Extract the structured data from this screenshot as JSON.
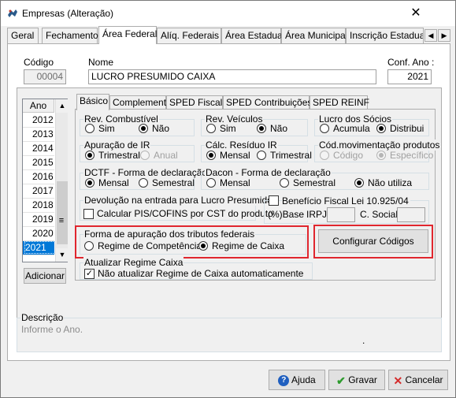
{
  "window": {
    "title": "Empresas (Alteração)",
    "close_symbol": "✕"
  },
  "top_tabs": [
    {
      "label": "Geral"
    },
    {
      "label": "Fechamento"
    },
    {
      "label": "Área Federal"
    },
    {
      "label": "Alíq. Federais"
    },
    {
      "label": "Área Estadual"
    },
    {
      "label": "Área Municipal"
    },
    {
      "label": "Inscrição Estadual S"
    }
  ],
  "header": {
    "codigo_label": "Código",
    "codigo_value": "00004",
    "nome_label": "Nome",
    "nome_value": "LUCRO PRESUMIDO CAIXA",
    "conf_ano_label": "Conf. Ano :",
    "conf_ano_value": "2021"
  },
  "year_grid": {
    "header": "Ano",
    "years": [
      "2012",
      "2013",
      "2014",
      "2015",
      "2016",
      "2017",
      "2018",
      "2019",
      "2020",
      "2021"
    ],
    "selected": "2021"
  },
  "adicionar_label": "Adicionar",
  "sub_tabs": [
    {
      "label": "Básico"
    },
    {
      "label": "Complemento"
    },
    {
      "label": "SPED Fiscal"
    },
    {
      "label": "SPED Contribuições"
    },
    {
      "label": "SPED REINF"
    }
  ],
  "groups": {
    "rev_combustivel": {
      "title": "Rev. Combustível",
      "opt1": "Sim",
      "opt2": "Não"
    },
    "rev_veiculos": {
      "title": "Rev. Veículos",
      "opt1": "Sim",
      "opt2": "Não"
    },
    "lucro_socios": {
      "title": "Lucro dos Sócios",
      "opt1": "Acumula",
      "opt2": "Distribui"
    },
    "apuracao_ir": {
      "title": "Apuração de IR",
      "opt1": "Trimestral",
      "opt2": "Anual"
    },
    "calc_residuo_ir": {
      "title": "Cálc. Resíduo IR",
      "opt1": "Mensal",
      "opt2": "Trimestral"
    },
    "cod_mov": {
      "title": "Cód.movimentação produtos",
      "opt1": "Código",
      "opt2": "Específico"
    },
    "dctf": {
      "title": "DCTF - Forma de declaração",
      "opt1": "Mensal",
      "opt2": "Semestral"
    },
    "dacon": {
      "title": "Dacon - Forma de declaração",
      "opt1": "Mensal",
      "opt2": "Semestral",
      "opt3": "Não utiliza"
    },
    "devolucao": {
      "title": "Devolução na entrada para Lucro Presumido",
      "check_label": "Calcular PIS/COFINS por CST do produto"
    },
    "beneficio": {
      "title": "Benefício Fiscal Lei 10.925/04",
      "base_label": "(%)Base",
      "irpj_label": "IRPJ",
      "csocial_label": "C. Social"
    },
    "forma_apuracao": {
      "title": "Forma de apuração dos tributos federais",
      "opt1": "Regime de Competência",
      "opt2": "Regime de Caixa"
    },
    "atualizar": {
      "title": "Atualizar Regime Caixa",
      "check_label": "Não atualizar Regime de Caixa automaticamente"
    }
  },
  "configurar_label": "Configurar Códigos",
  "descricao": {
    "title": "Descrição",
    "text": "Informe o Ano.",
    "dot": "."
  },
  "buttons": {
    "ajuda": "Ajuda",
    "gravar": "Gravar",
    "cancelar": "Cancelar"
  },
  "colors": {
    "highlight": "#e0262e",
    "selection": "#0078d7"
  }
}
